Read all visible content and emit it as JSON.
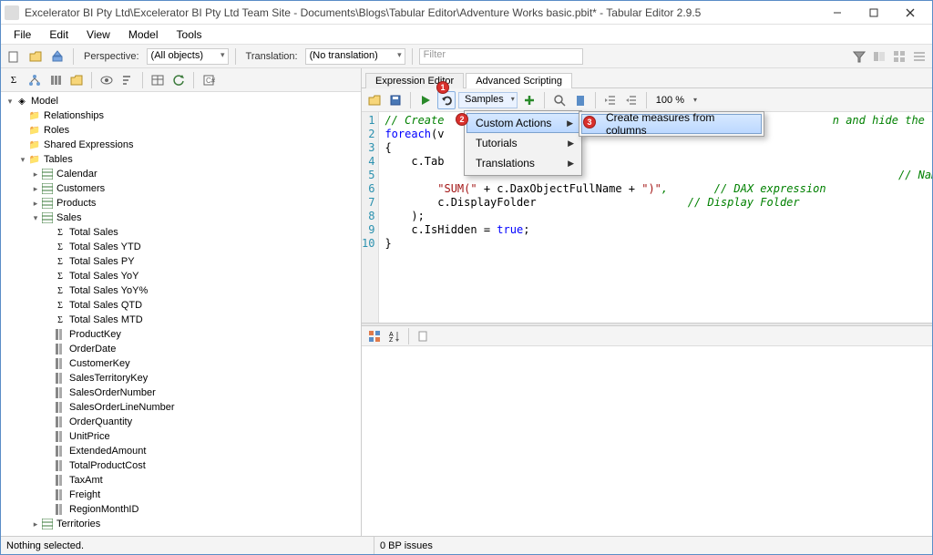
{
  "window": {
    "title": "Excelerator BI Pty Ltd\\Excelerator BI Pty Ltd Team Site - Documents\\Blogs\\Tabular Editor\\Adventure Works basic.pbit* - Tabular Editor 2.9.5"
  },
  "menu": {
    "file": "File",
    "edit": "Edit",
    "view": "View",
    "model": "Model",
    "tools": "Tools"
  },
  "toolbar": {
    "perspective_label": "Perspective:",
    "perspective_value": "(All objects)",
    "translation_label": "Translation:",
    "translation_value": "(No translation)",
    "filter_placeholder": "Filter"
  },
  "tree": {
    "root": "Model",
    "folders": {
      "relationships": "Relationships",
      "roles": "Roles",
      "shared_expr": "Shared Expressions",
      "tables": "Tables"
    },
    "tables": {
      "calendar": "Calendar",
      "customers": "Customers",
      "products": "Products",
      "sales": "Sales",
      "territories": "Territories"
    },
    "measures": [
      "Total Sales",
      "Total Sales YTD",
      "Total Sales PY",
      "Total Sales YoY",
      "Total Sales YoY%",
      "Total Sales QTD",
      "Total Sales MTD"
    ],
    "columns": [
      "ProductKey",
      "OrderDate",
      "CustomerKey",
      "SalesTerritoryKey",
      "SalesOrderNumber",
      "SalesOrderLineNumber",
      "OrderQuantity",
      "UnitPrice",
      "ExtendedAmount",
      "TotalProductCost",
      "TaxAmt",
      "Freight",
      "RegionMonthID"
    ]
  },
  "tabs": {
    "expr": "Expression Editor",
    "adv": "Advanced Scripting"
  },
  "script_toolbar": {
    "samples": "Samples",
    "zoom": "100 %"
  },
  "dropdown": {
    "custom_actions": "Custom Actions",
    "tutorials": "Tutorials",
    "translations": "Translations",
    "create_measures": "Create measures from columns"
  },
  "code": {
    "l1a": "// Create",
    "l1b": "n and hide the column.",
    "l2a": "foreach",
    "l2b": "(v",
    "l3": "{",
    "l4": "    c.Tab",
    "l5a": "        ",
    "l5b": "                              // Name",
    "l6a": "        \"SUM(\"",
    "l6b": " + c.DaxObjectFullName + ",
    "l6c": "\")\"",
    "l6d": ",       // DAX expression",
    "l7a": "        c.DisplayFolder                       ",
    "l7b": "// Display Folder",
    "l8": "    );",
    "l9a": "    c.IsHidden = ",
    "l9b": "true",
    "l9c": ";",
    "l10": "}"
  },
  "status": {
    "left": "Nothing selected.",
    "right": "0 BP issues"
  },
  "badges": {
    "b1": "1",
    "b2": "2",
    "b3": "3"
  }
}
